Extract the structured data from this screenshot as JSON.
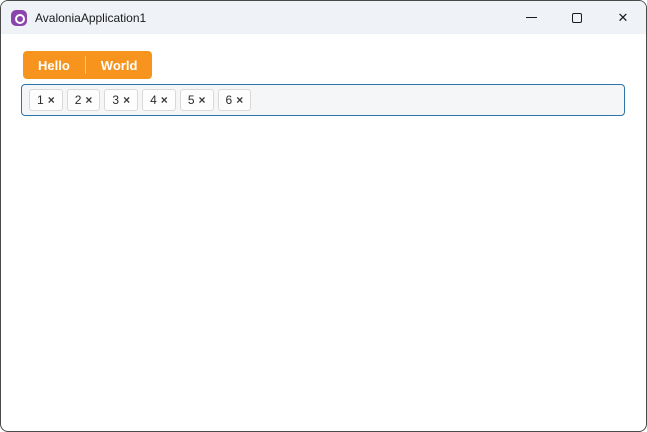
{
  "window": {
    "title": "AvaloniaApplication1"
  },
  "icons": {
    "avalonia-logo-icon": "purple-circle-with-white-ring (css shape)",
    "minimize-icon": "css-line",
    "maximize-icon": "css-square",
    "close-icon": "✕",
    "chip-remove-icon": "×"
  },
  "colors": {
    "titlebar_bg": "#eff2f7",
    "accent_orange": "#f7941e",
    "chips_border_blue": "#2e74a8",
    "logo_purple": "#8b44ac"
  },
  "split_button": {
    "primary_label": "Hello",
    "secondary_label": "World"
  },
  "chips": {
    "items": [
      {
        "label": "1"
      },
      {
        "label": "2"
      },
      {
        "label": "3"
      },
      {
        "label": "4"
      },
      {
        "label": "5"
      },
      {
        "label": "6"
      }
    ]
  }
}
